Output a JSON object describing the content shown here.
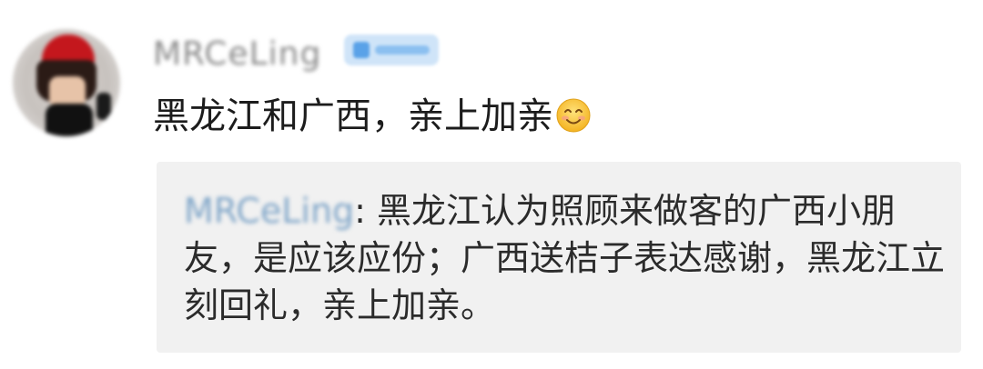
{
  "comment": {
    "username": "MRCeLing",
    "badge": "",
    "text": "黑龙江和广西，亲上加亲",
    "emoji": "smiling-face-icon"
  },
  "quote": {
    "author": "MRCeLing",
    "separator": ":",
    "text": " 黑龙江认为照顾来做客的广西小朋友，是应该应份；广西送桔子表达感谢，黑龙江立刻回礼，亲上加亲。"
  },
  "colors": {
    "link_blue": "#7fa5c8",
    "quote_background": "#f1f1f1",
    "text": "#1c1c1c"
  }
}
